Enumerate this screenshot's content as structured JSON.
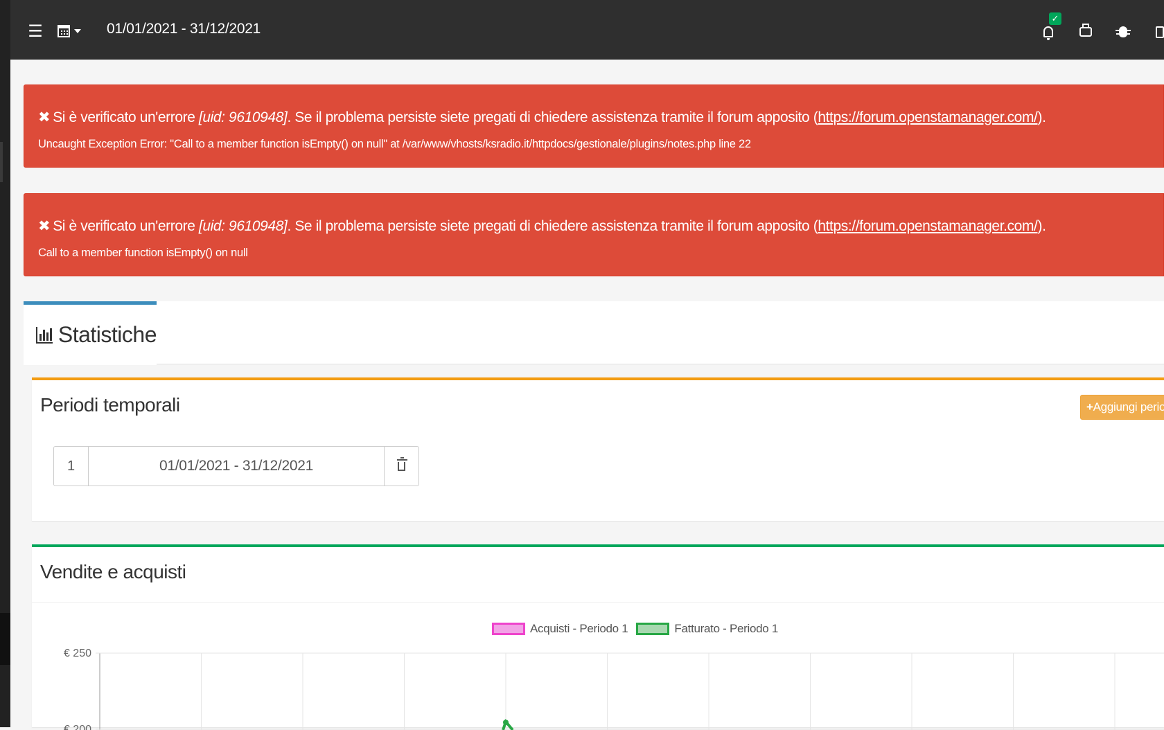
{
  "topbar": {
    "date_range": "01/01/2021 - 31/12/2021"
  },
  "alerts": [
    {
      "prefix": "Si è verificato un'errore ",
      "uid": "[uid: 9610948]",
      "middle": ". Se il problema persiste siete pregati di chiedere assistenza tramite il forum apposito (",
      "link": "https://forum.openstamanager.com/",
      "suffix": ").",
      "detail": "Uncaught Exception Error: \"Call to a member function isEmpty() on null\" at /var/www/vhosts/ksradio.it/httpdocs/gestionale/plugins/notes.php line 22"
    },
    {
      "prefix": "Si è verificato un'errore ",
      "uid": "[uid: 9610948]",
      "middle": ". Se il problema persiste siete pregati di chiedere assistenza tramite il forum apposito (",
      "link": "https://forum.openstamanager.com/",
      "suffix": ").",
      "detail": "Call to a member function isEmpty() on null"
    }
  ],
  "tabs": {
    "active_label": "Statistiche"
  },
  "periods": {
    "title": "Periodi temporali",
    "add_button": "Aggiungi perio",
    "items": [
      {
        "index": "1",
        "range": "01/01/2021 - 31/12/2021"
      }
    ]
  },
  "sales": {
    "title": "Vendite e acquisti"
  },
  "chart_data": {
    "type": "line",
    "title": "",
    "legend_position": "top",
    "series": [
      {
        "name": "Acquisti - Periodo 1",
        "color": "#ee44cc",
        "fill": "#f2a2e6"
      },
      {
        "name": "Fatturato - Periodo 1",
        "color": "#28a745",
        "fill": "#a8d8b0"
      }
    ],
    "y_ticks": [
      "€ 250",
      "€ 200"
    ],
    "grid": true
  },
  "colors": {
    "navbar": "#2f2f2f",
    "danger": "#dd4b39",
    "primary": "#3c8dbc",
    "warning": "#f39c12",
    "success": "#00a65a"
  }
}
